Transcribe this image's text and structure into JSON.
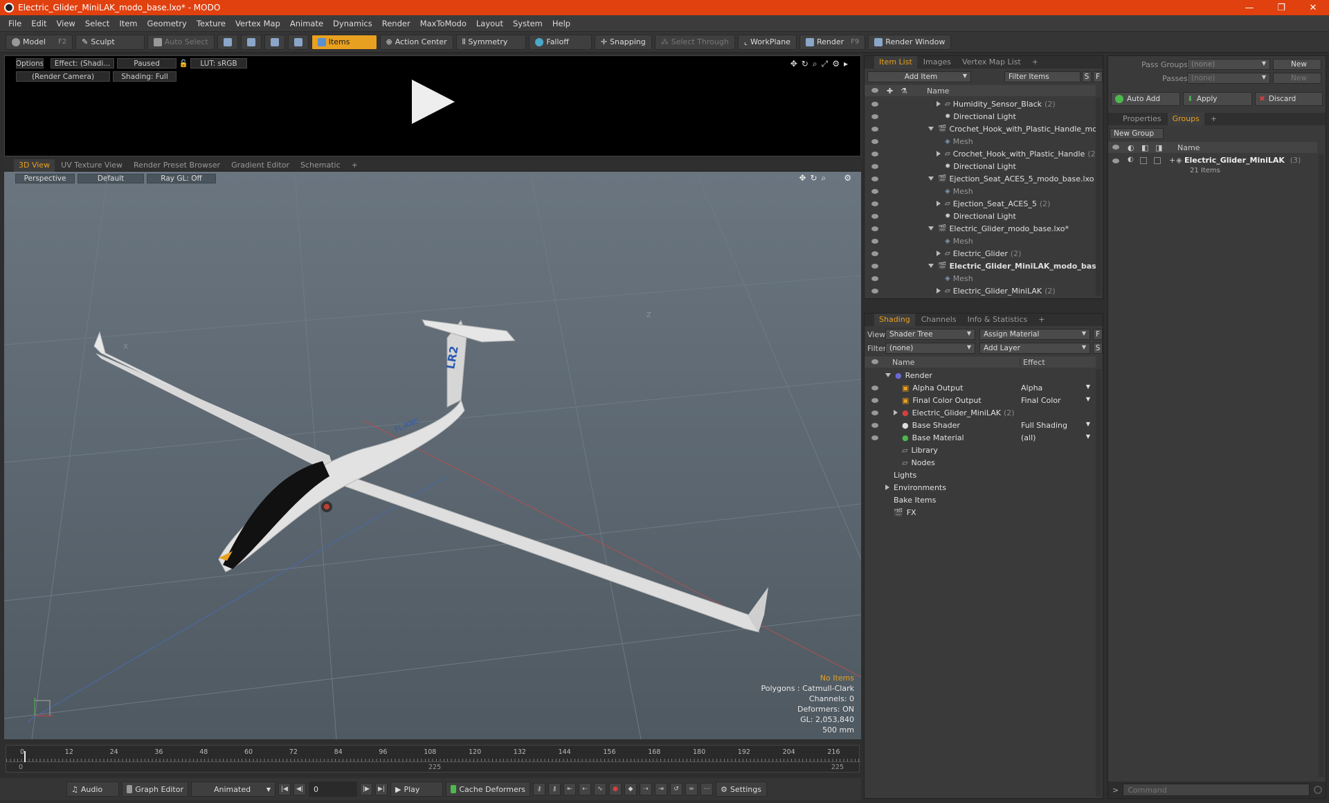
{
  "window": {
    "title": "Electric_Glider_MiniLAK_modo_base.lxo* - MODO",
    "minimize": "—",
    "restore": "❐",
    "close": "✕"
  },
  "menu": [
    "File",
    "Edit",
    "View",
    "Select",
    "Item",
    "Geometry",
    "Texture",
    "Vertex Map",
    "Animate",
    "Dynamics",
    "Render",
    "MaxToModo",
    "Layout",
    "System",
    "Help"
  ],
  "toolbar": {
    "model": "Model",
    "model_key": "F2",
    "sculpt": "Sculpt",
    "auto_select": "Auto Select",
    "items": "Items",
    "action_center": "Action Center",
    "symmetry": "Symmetry",
    "falloff": "Falloff",
    "snapping": "Snapping",
    "select_through": "Select Through",
    "workplane": "WorkPlane",
    "render": "Render",
    "render_key": "F9",
    "render_window": "Render Window"
  },
  "preview": {
    "options": "Options",
    "effect": "Effect: (Shadi...",
    "paused": "Paused",
    "lut": "LUT: sRGB",
    "camera": "(Render Camera)",
    "shading": "Shading: Full"
  },
  "viewport_tabs": [
    "3D View",
    "UV Texture View",
    "Render Preset Browser",
    "Gradient Editor",
    "Schematic",
    "+"
  ],
  "viewport": {
    "perspective": "Perspective",
    "default": "Default",
    "raygl": "Ray GL: Off",
    "tail_label": "LR2",
    "reg_label": "FL-RNC",
    "axis_x": "X",
    "axis_z": "Z",
    "stats": {
      "no_items": "No Items",
      "polygons": "Polygons : Catmull-Clark",
      "channels": "Channels: 0",
      "deformers": "Deformers: ON",
      "gl": "GL: 2,053,840",
      "scale": "500 mm"
    }
  },
  "timeline": {
    "ticks": [
      "0",
      "12",
      "24",
      "36",
      "48",
      "60",
      "72",
      "84",
      "96",
      "108",
      "120",
      "132",
      "144",
      "156",
      "168",
      "180",
      "192",
      "204",
      "216"
    ],
    "start": "0",
    "mid": "225",
    "end": "225"
  },
  "bottombar": {
    "audio": "Audio",
    "graph_editor": "Graph Editor",
    "animated": "Animated",
    "frame": "0",
    "play": "Play",
    "cache": "Cache Deformers",
    "settings": "Settings"
  },
  "item_list": {
    "tabs": [
      "Item List",
      "Images",
      "Vertex Map List",
      "+"
    ],
    "add_item": "Add Item",
    "filter": "Filter Items",
    "s": "S",
    "f": "F",
    "col_name": "Name",
    "rows": [
      {
        "label": "Humidity_Sensor_Black",
        "count": "(2)",
        "indent": 2,
        "kind": "group",
        "caret": "right"
      },
      {
        "label": "Directional Light",
        "count": "",
        "indent": 2,
        "kind": "light",
        "caret": ""
      },
      {
        "label": "Crochet_Hook_with_Plastic_Handle_modo...",
        "count": "",
        "indent": 1,
        "kind": "scene",
        "caret": "down"
      },
      {
        "label": "Mesh",
        "count": "",
        "indent": 2,
        "kind": "mesh",
        "caret": ""
      },
      {
        "label": "Crochet_Hook_with_Plastic_Handle",
        "count": "(2)",
        "indent": 2,
        "kind": "group",
        "caret": "right"
      },
      {
        "label": "Directional Light",
        "count": "",
        "indent": 2,
        "kind": "light",
        "caret": ""
      },
      {
        "label": "Ejection_Seat_ACES_5_modo_base.lxo",
        "count": "",
        "indent": 1,
        "kind": "scene",
        "caret": "down"
      },
      {
        "label": "Mesh",
        "count": "",
        "indent": 2,
        "kind": "mesh",
        "caret": ""
      },
      {
        "label": "Ejection_Seat_ACES_5",
        "count": "(2)",
        "indent": 2,
        "kind": "group",
        "caret": "right"
      },
      {
        "label": "Directional Light",
        "count": "",
        "indent": 2,
        "kind": "light",
        "caret": ""
      },
      {
        "label": "Electric_Glider_modo_base.lxo*",
        "count": "",
        "indent": 1,
        "kind": "scene",
        "caret": "down"
      },
      {
        "label": "Mesh",
        "count": "",
        "indent": 2,
        "kind": "mesh",
        "caret": ""
      },
      {
        "label": "Electric_Glider",
        "count": "(2)",
        "indent": 2,
        "kind": "group",
        "caret": "right"
      },
      {
        "label": "Electric_Glider_MiniLAK_modo_bas ...",
        "count": "",
        "indent": 1,
        "kind": "scene",
        "caret": "down",
        "bold": true
      },
      {
        "label": "Mesh",
        "count": "",
        "indent": 2,
        "kind": "mesh",
        "caret": ""
      },
      {
        "label": "Electric_Glider_MiniLAK",
        "count": "(2)",
        "indent": 2,
        "kind": "group",
        "caret": "right"
      }
    ]
  },
  "shading": {
    "tabs": [
      "Shading",
      "Channels",
      "Info & Statistics",
      "+"
    ],
    "view_label": "View",
    "view_value": "Shader Tree",
    "assign": "Assign Material",
    "f": "F",
    "filter_label": "Filter",
    "filter_value": "(none)",
    "add_layer": "Add Layer",
    "s": "S",
    "col_name": "Name",
    "col_effect": "Effect",
    "rows": [
      {
        "label": "Render",
        "effect": "",
        "indent": 0,
        "caret": "down",
        "eye": false,
        "icon": "render"
      },
      {
        "label": "Alpha Output",
        "effect": "Alpha",
        "indent": 1,
        "caret": "",
        "eye": true,
        "icon": "output"
      },
      {
        "label": "Final Color Output",
        "effect": "Final Color",
        "indent": 1,
        "caret": "",
        "eye": true,
        "icon": "output"
      },
      {
        "label": "Electric_Glider_MiniLAK",
        "count": "(2) (...",
        "effect": "",
        "indent": 1,
        "caret": "right",
        "eye": true,
        "icon": "material"
      },
      {
        "label": "Base Shader",
        "effect": "Full Shading",
        "indent": 1,
        "caret": "",
        "eye": true,
        "icon": "shader"
      },
      {
        "label": "Base Material",
        "effect": "(all)",
        "indent": 1,
        "caret": "",
        "eye": true,
        "icon": "basemat"
      },
      {
        "label": "Library",
        "effect": "",
        "indent": 1,
        "caret": "",
        "eye": false,
        "icon": "folder"
      },
      {
        "label": "Nodes",
        "effect": "",
        "indent": 1,
        "caret": "",
        "eye": false,
        "icon": "folder"
      },
      {
        "label": "Lights",
        "effect": "",
        "indent": 0,
        "caret": "",
        "eye": false,
        "icon": ""
      },
      {
        "label": "Environments",
        "effect": "",
        "indent": 0,
        "caret": "right",
        "eye": false,
        "icon": ""
      },
      {
        "label": "Bake Items",
        "effect": "",
        "indent": 0,
        "caret": "",
        "eye": false,
        "icon": ""
      },
      {
        "label": "FX",
        "effect": "",
        "indent": 0,
        "caret": "",
        "eye": false,
        "icon": "fx"
      }
    ]
  },
  "groups_panel": {
    "pass_groups": "Pass Groups",
    "pass_groups_value": "(none)",
    "new": "New",
    "passes": "Passes",
    "passes_value": "(none)",
    "new2": "New",
    "auto_add": "Auto Add",
    "apply": "Apply",
    "discard": "Discard",
    "tabs": [
      "Properties",
      "Groups",
      "+"
    ],
    "new_group": "New Group",
    "col_name": "Name",
    "group_name": "Electric_Glider_MiniLAK",
    "group_count": "(3)",
    "group_items": "21 Items",
    "command_placeholder": "Command"
  },
  "colors": {
    "accent": "#e8a020",
    "titlebar": "#e1400f"
  }
}
